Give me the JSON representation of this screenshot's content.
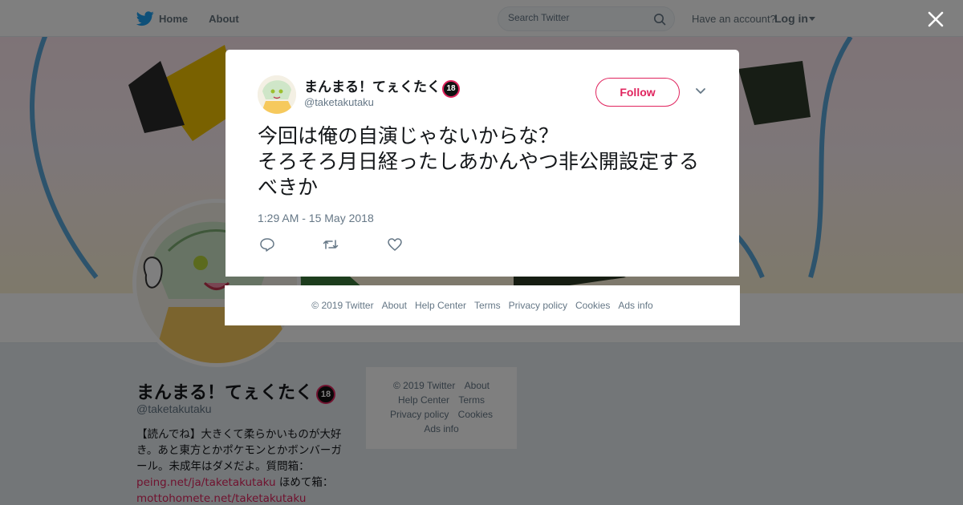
{
  "topbar": {
    "nav": [
      {
        "label": "Home"
      },
      {
        "label": "About"
      }
    ],
    "search_placeholder": "Search Twitter",
    "have_account": "Have an account?",
    "login": "Log in"
  },
  "profile": {
    "name": "まんまる！てぇくたく",
    "badge": "18",
    "handle": "@taketakutaku",
    "bio_text": "【読んでね】大きくて柔らかいものが大好き。あと東方とかポケモンとかボンバーガール。未成年はダメだよ。質問箱：",
    "bio_link1": "peing.net/ja/taketakutaku",
    "bio_mid": " ほめて箱：",
    "bio_link2": "mottohomete.net/taketakutaku"
  },
  "side_footer": {
    "items": [
      "© 2019 Twitter",
      "About",
      "Help Center",
      "Terms",
      "Privacy policy",
      "Cookies",
      "Ads info"
    ]
  },
  "tweet": {
    "author_name": "まんまる！てぇくたく",
    "badge": "18",
    "author_handle": "@taketakutaku",
    "follow_label": "Follow",
    "text": "今回は俺の自演じゃないからな？\nそろそろ月日経ったしあかんやつ非公開設定するべきか",
    "timestamp": "1:29 AM - 15 May 2018"
  },
  "modal_footer": {
    "items": [
      "© 2019 Twitter",
      "About",
      "Help Center",
      "Terms",
      "Privacy policy",
      "Cookies",
      "Ads info"
    ]
  },
  "colors": {
    "brand_blue": "#1da1f2",
    "accent_pink": "#e0245e",
    "muted_text": "#657786"
  },
  "icons": [
    "twitter-bird-icon",
    "search-icon",
    "caret-down-icon",
    "close-icon",
    "chevron-down-icon",
    "reply-icon",
    "retweet-icon",
    "like-icon"
  ]
}
